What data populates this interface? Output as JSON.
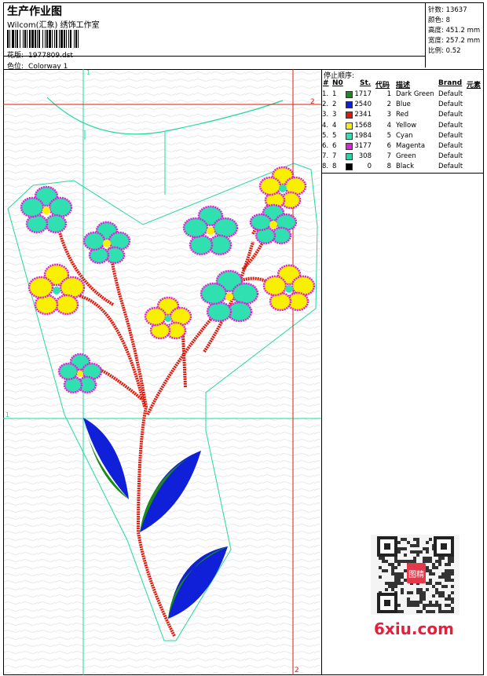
{
  "header": {
    "title": "生产作业图",
    "studio": "Wilcom(汇象) 绣饰工作室",
    "pattern_label": "花版:",
    "pattern_value": "1977809.dst",
    "colorway_label": "色位:",
    "colorway_value": "Colorway 1"
  },
  "stats": {
    "stitches_label": "针数:",
    "stitches_value": "13637",
    "colors_label": "颜色:",
    "colors_value": "8",
    "height_label": "高度:",
    "height_value": "451.2 mm",
    "width_label": "宽度:",
    "width_value": "257.2 mm",
    "scale_label": "比例:",
    "scale_value": "0.52"
  },
  "stop_sequence": {
    "title": "停止顺序:",
    "headers": {
      "hash": "#",
      "no": "N0",
      "st": "St.",
      "code": "代码",
      "desc": "描述",
      "brand": "Brand",
      "element": "元素"
    },
    "rows": [
      {
        "num": "1.",
        "no": "1",
        "color": "#1a8a1a",
        "st": "1717",
        "code": "1",
        "desc": "Dark Green",
        "brand": "Default"
      },
      {
        "num": "2.",
        "no": "2",
        "color": "#1020d8",
        "st": "2540",
        "code": "2",
        "desc": "Blue",
        "brand": "Default"
      },
      {
        "num": "3.",
        "no": "3",
        "color": "#e0180c",
        "st": "2341",
        "code": "3",
        "desc": "Red",
        "brand": "Default"
      },
      {
        "num": "4.",
        "no": "4",
        "color": "#f8f000",
        "st": "1568",
        "code": "4",
        "desc": "Yellow",
        "brand": "Default"
      },
      {
        "num": "5.",
        "no": "5",
        "color": "#30e0b0",
        "st": "1984",
        "code": "5",
        "desc": "Cyan",
        "brand": "Default"
      },
      {
        "num": "6.",
        "no": "6",
        "color": "#e020d8",
        "st": "3177",
        "code": "6",
        "desc": "Magenta",
        "brand": "Default"
      },
      {
        "num": "7.",
        "no": "7",
        "color": "#20d8a0",
        "st": "308",
        "code": "7",
        "desc": "Green",
        "brand": "Default"
      },
      {
        "num": "8.",
        "no": "8",
        "color": "#000000",
        "st": "0",
        "code": "8",
        "desc": "Black",
        "brand": "Default"
      }
    ]
  },
  "guides": {
    "v_top": "1",
    "h_top": "2",
    "h_left": "1",
    "v_bottom": "2"
  },
  "watermark": {
    "text": "6xiu.com",
    "stamp": "图精"
  }
}
